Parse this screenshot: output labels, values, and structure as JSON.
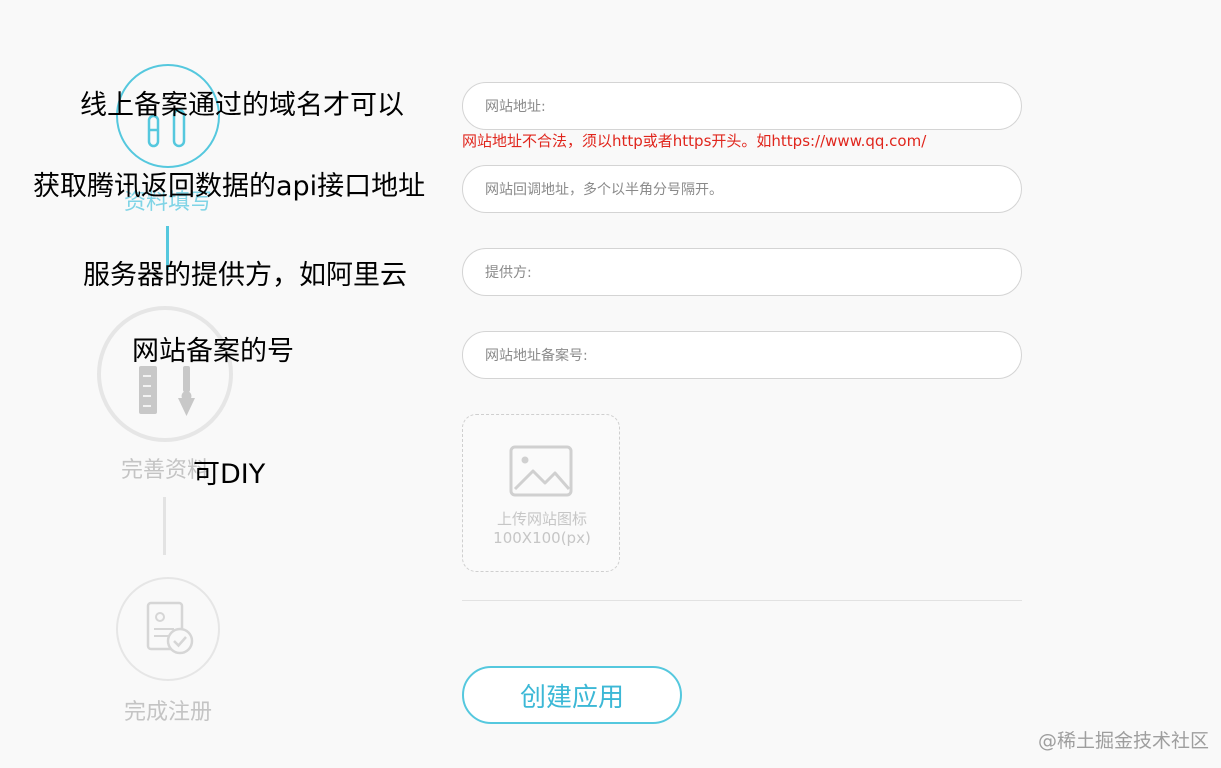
{
  "steps": [
    {
      "label": "资料填写",
      "icon": "test-tubes-icon",
      "state": "active"
    },
    {
      "label": "完善资料",
      "icon": "ruler-pen-icon",
      "state": "pending"
    },
    {
      "label": "完成注册",
      "icon": "document-check-icon",
      "state": "pending"
    }
  ],
  "annotations": {
    "domain_note": "线上备案通过的域名才可以",
    "callback_note": "获取腾讯返回数据的api接口地址",
    "provider_note": "服务器的提供方，如阿里云",
    "record_note": "网站备案的号",
    "icon_note": "可DIY"
  },
  "form": {
    "site_url_placeholder": "网站地址:",
    "site_url_error": "网站地址不合法，须以http或者https开头。如https://www.qq.com/",
    "callback_placeholder": "网站回调地址，多个以半角分号隔开。",
    "provider_placeholder": "提供方:",
    "record_placeholder": "网站地址备案号:",
    "upload_label": "上传网站图标",
    "upload_size": "100X100(px)",
    "submit_label": "创建应用"
  },
  "watermark": "@稀土掘金技术社区",
  "colors": {
    "accent": "#55c8de",
    "error": "#e0261d",
    "inactive": "#c4c4c4",
    "background": "#f9f9f9"
  }
}
